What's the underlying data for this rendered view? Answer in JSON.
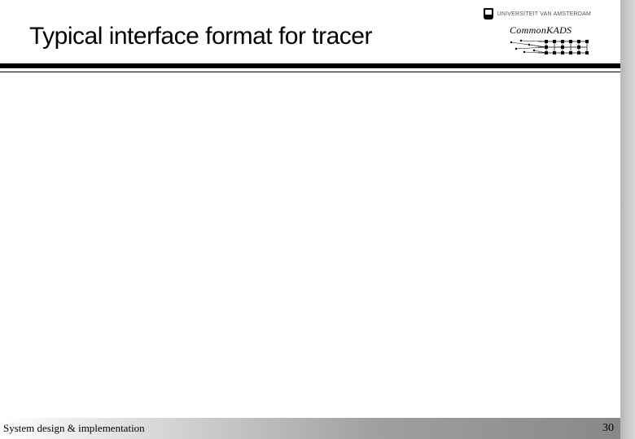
{
  "header": {
    "title": "Typical interface format for tracer",
    "logo1_text": "UNIVERSITEIT VAN AMSTERDAM",
    "logo2_prefix": "Common",
    "logo2_suffix": "KADS"
  },
  "footer": {
    "left_text": "System design & implementation",
    "page_number": "30"
  }
}
